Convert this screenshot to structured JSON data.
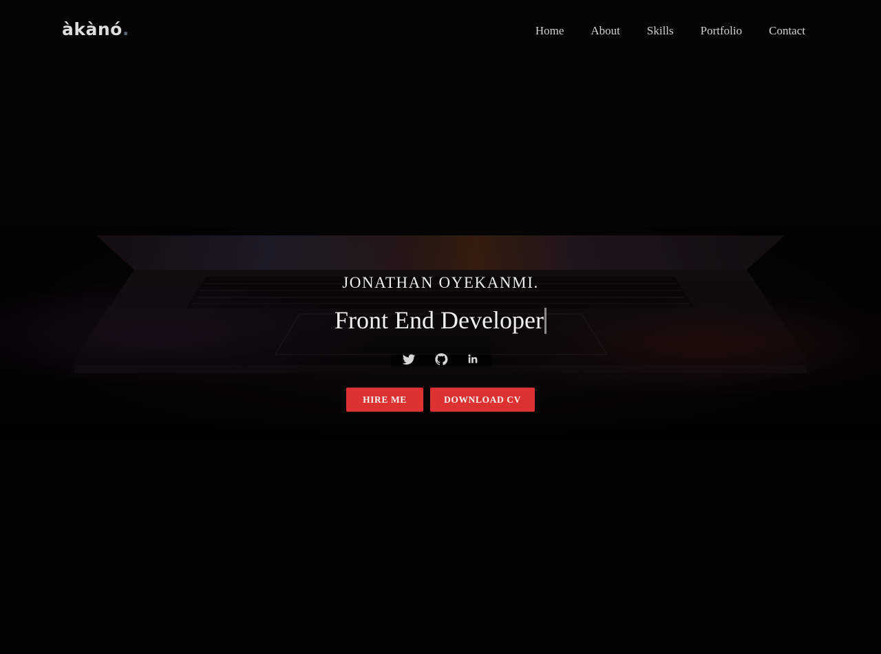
{
  "brand": {
    "logo_text": "àkànó",
    "logo_dot": ".",
    "accent": "#dc3232",
    "logo_dot_color": "#5d6877"
  },
  "nav": {
    "items": [
      {
        "label": "Home"
      },
      {
        "label": "About"
      },
      {
        "label": "Skills"
      },
      {
        "label": "Portfolio"
      },
      {
        "label": "Contact"
      }
    ]
  },
  "hero": {
    "name": "JONATHAN OYEKANMI.",
    "role": "Front End Developer",
    "social": [
      {
        "icon": "twitter-icon"
      },
      {
        "icon": "github-icon"
      },
      {
        "icon": "linkedin-icon"
      }
    ],
    "buttons": {
      "hire": "HIRE ME",
      "cv": "DOWNLOAD CV"
    }
  }
}
